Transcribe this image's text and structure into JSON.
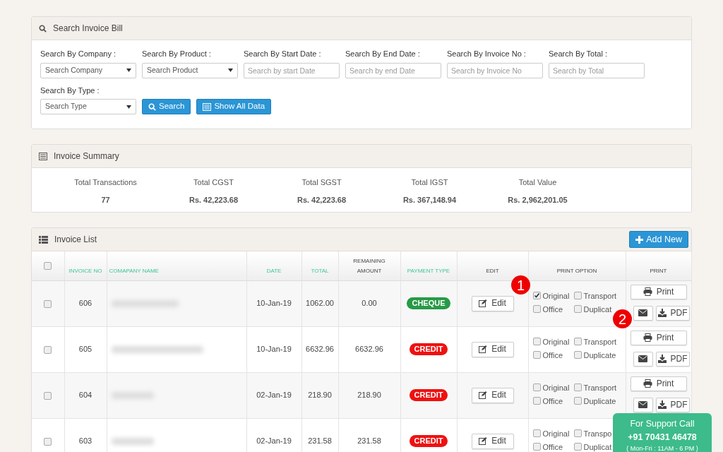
{
  "search_panel": {
    "title": "Search Invoice Bill",
    "filters": [
      {
        "label": "Search By Company :",
        "kind": "select",
        "placeholder": "Search Company"
      },
      {
        "label": "Search By Product :",
        "kind": "select",
        "placeholder": "Search Product"
      },
      {
        "label": "Search By Start Date :",
        "kind": "input",
        "placeholder": "Search by start Date"
      },
      {
        "label": "Search By End Date :",
        "kind": "input",
        "placeholder": "Search by end Date"
      },
      {
        "label": "Search By Invoice No :",
        "kind": "input",
        "placeholder": "Search by Invoice No"
      },
      {
        "label": "Search By Total :",
        "kind": "input",
        "placeholder": "Search by Total"
      },
      {
        "label": "Search By Type :",
        "kind": "select",
        "placeholder": "Search Type"
      }
    ],
    "buttons": [
      {
        "label": "Search",
        "kind": "search"
      },
      {
        "label": "Show All Data",
        "kind": "list"
      }
    ]
  },
  "summary_panel": {
    "title": "Invoice Summary",
    "stats": [
      {
        "label": "Total Transactions",
        "value": "77"
      },
      {
        "label": "Total CGST",
        "value": "Rs. 42,223.68"
      },
      {
        "label": "Total SGST",
        "value": "Rs. 42,223.68"
      },
      {
        "label": "Total IGST",
        "value": "Rs. 367,148.94"
      },
      {
        "label": "Total Value",
        "value": "Rs. 2,962,201.05"
      }
    ]
  },
  "invoice_list": {
    "title": "Invoice List",
    "add_button": "Add New",
    "columns": [
      {
        "label": "INVOICE NO",
        "highlight": true
      },
      {
        "label": "COMAPANY NAME",
        "highlight": true
      },
      {
        "label": "DATE",
        "highlight": true
      },
      {
        "label": "TOTAL",
        "highlight": true
      },
      {
        "label": "REMAINING AMOUNT",
        "highlight": false
      },
      {
        "label": "PAYMENT TYPE",
        "highlight": true
      },
      {
        "label": "EDIT",
        "highlight": false
      },
      {
        "label": "PRINT OPTION",
        "highlight": false
      },
      {
        "label": "PRINT",
        "highlight": false
      }
    ],
    "header_checked": false,
    "rows": [
      {
        "checked": false,
        "invoice_no": "606",
        "date": "10-Jan-19",
        "total": "1062.00",
        "remaining": "0.00",
        "payment_type": "CHEQUE",
        "color": "#279a47",
        "edit": "Edit",
        "options": [
          {
            "label": "Original",
            "checked": true
          },
          {
            "label": "Transport",
            "checked": false
          },
          {
            "label": "Office",
            "checked": false
          },
          {
            "label": "Duplicat",
            "checked": false
          }
        ],
        "print": "Print",
        "pdf": "PDF"
      },
      {
        "checked": false,
        "invoice_no": "605",
        "date": "10-Jan-19",
        "total": "6632.96",
        "remaining": "6632.96",
        "payment_type": "CREDIT",
        "color": "#ee1111",
        "edit": "Edit",
        "options": [
          {
            "label": "Original",
            "checked": false
          },
          {
            "label": "Transport",
            "checked": false
          },
          {
            "label": "Office",
            "checked": false
          },
          {
            "label": "Duplicate",
            "checked": false
          }
        ],
        "print": "Print",
        "pdf": "PDF"
      },
      {
        "checked": false,
        "invoice_no": "604",
        "date": "02-Jan-19",
        "total": "218.90",
        "remaining": "218.90",
        "payment_type": "CREDIT",
        "color": "#ee1111",
        "edit": "Edit",
        "options": [
          {
            "label": "Original",
            "checked": false
          },
          {
            "label": "Transport",
            "checked": false
          },
          {
            "label": "Office",
            "checked": false
          },
          {
            "label": "Duplicate",
            "checked": false
          }
        ],
        "print": "Print",
        "pdf": "PDF"
      },
      {
        "checked": false,
        "invoice_no": "603",
        "date": "02-Jan-19",
        "total": "231.58",
        "remaining": "231.58",
        "payment_type": "CREDIT",
        "color": "#ee1111",
        "edit": "Edit",
        "options": [
          {
            "label": "Original",
            "checked": false
          },
          {
            "label": "Transpo",
            "checked": false
          },
          {
            "label": "Office",
            "checked": false
          },
          {
            "label": "Duplicat",
            "checked": false
          }
        ]
      }
    ]
  },
  "callouts": [
    "1",
    "2"
  ],
  "support_box": {
    "title": "For Support Call",
    "phone": "+91 70431 46478",
    "hours": "( Mon-Fri : 11AM - 6 PM )"
  }
}
